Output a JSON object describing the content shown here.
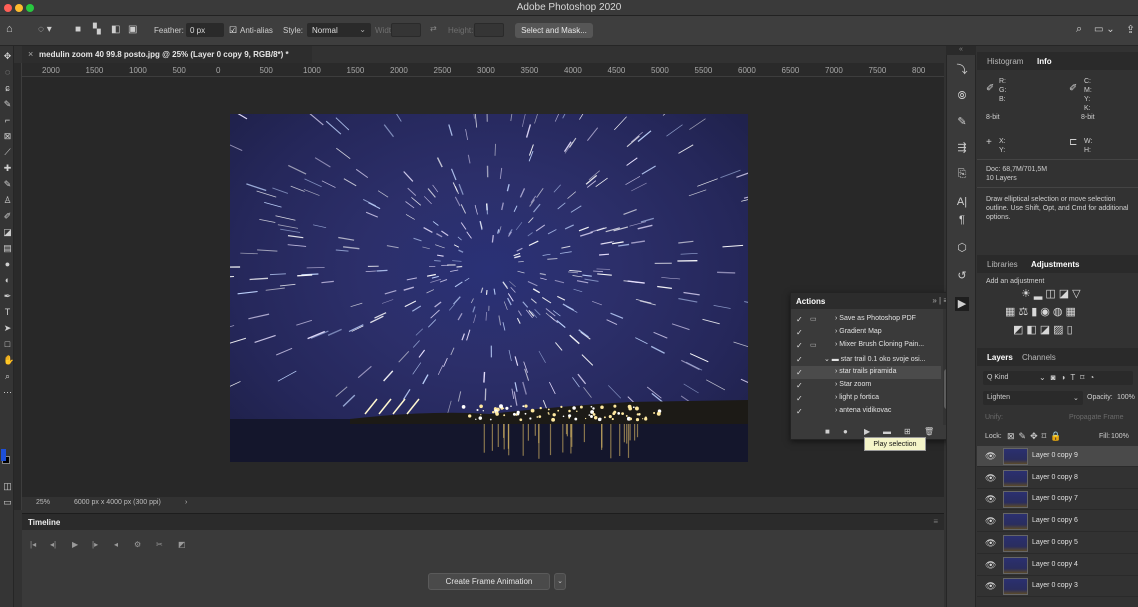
{
  "app": {
    "title": "Adobe Photoshop 2020"
  },
  "options_bar": {
    "feather_label": "Feather:",
    "feather_value": "0 px",
    "anti_alias_label": "Anti-alias",
    "style_label": "Style:",
    "style_value": "Normal",
    "width_label": "Width:",
    "height_label": "Height:",
    "select_mask_label": "Select and Mask..."
  },
  "document": {
    "tab_label": "medulin zoom 40 99.8 posto.jpg @ 25% (Layer 0 copy 9, RGB/8*) *",
    "zoom": "25%",
    "info": "6000 px x 4000 px (300 ppi)",
    "ruler_labels": [
      "2000",
      "1500",
      "1000",
      "500",
      "0",
      "500",
      "1000",
      "1500",
      "2000",
      "2500",
      "3000",
      "3500",
      "4000",
      "4500",
      "5000",
      "5500",
      "6000",
      "6500",
      "7000",
      "7500",
      "800"
    ]
  },
  "timeline": {
    "title": "Timeline",
    "create_label": "Create Frame Animation"
  },
  "info_panel": {
    "tabs": [
      "Histogram",
      "Info"
    ],
    "active_tab": "Info",
    "rgb_labels": "R:\nG:\nB:",
    "cmyk_labels": "C:\nM:\nY:\nK:",
    "bit_left": "8-bit",
    "bit_right": "8-bit",
    "xy_labels": "X:\nY:",
    "wh_labels": "W:\nH:",
    "doc_size": "Doc: 68,7M/701,5M",
    "layers_count": "10 Layers",
    "hint": "Draw elliptical selection or move selection outline.  Use Shift, Opt, and Cmd for additional options."
  },
  "adjustments_panel": {
    "tabs": [
      "Libraries",
      "Adjustments"
    ],
    "active_tab": "Adjustments",
    "add_label": "Add an adjustment"
  },
  "layers_panel": {
    "tabs": [
      "Layers",
      "Channels"
    ],
    "active_tab": "Layers",
    "kind_label": "Q Kind",
    "blend_mode": "Lighten",
    "opacity_label": "Opacity:",
    "opacity_value": "100%",
    "unify_label": "Unify:",
    "propagate_label": "Propagate Frame",
    "lock_label": "Lock:",
    "fill_label": "Fill:",
    "fill_value": "100%",
    "layers": [
      {
        "name": "Layer 0 copy 9",
        "selected": true
      },
      {
        "name": "Layer 0 copy 8",
        "selected": false
      },
      {
        "name": "Layer 0 copy 7",
        "selected": false
      },
      {
        "name": "Layer 0 copy 6",
        "selected": false
      },
      {
        "name": "Layer 0 copy 5",
        "selected": false
      },
      {
        "name": "Layer 0 copy 4",
        "selected": false
      },
      {
        "name": "Layer 0 copy 3",
        "selected": false
      }
    ]
  },
  "actions_panel": {
    "title": "Actions",
    "items": [
      {
        "name": "Save as Photoshop PDF",
        "indent": 1,
        "selected": false
      },
      {
        "name": "Gradient Map",
        "indent": 1,
        "selected": false
      },
      {
        "name": "Mixer Brush Cloning Pain...",
        "indent": 1,
        "selected": false
      },
      {
        "name": "star trail 0.1 oko svoje osi...",
        "indent": 0,
        "selected": false
      },
      {
        "name": "star trails piramida",
        "indent": 1,
        "selected": true
      },
      {
        "name": "Star zoom",
        "indent": 1,
        "selected": false
      },
      {
        "name": "light p fortica",
        "indent": 1,
        "selected": false
      },
      {
        "name": "antena vidikovac",
        "indent": 1,
        "selected": false
      }
    ],
    "tooltip": "Play selection"
  },
  "colors": {
    "accent": "#1473e6",
    "traffic_red": "#ff5f57",
    "traffic_yellow": "#febc2e",
    "traffic_green": "#28c840"
  }
}
